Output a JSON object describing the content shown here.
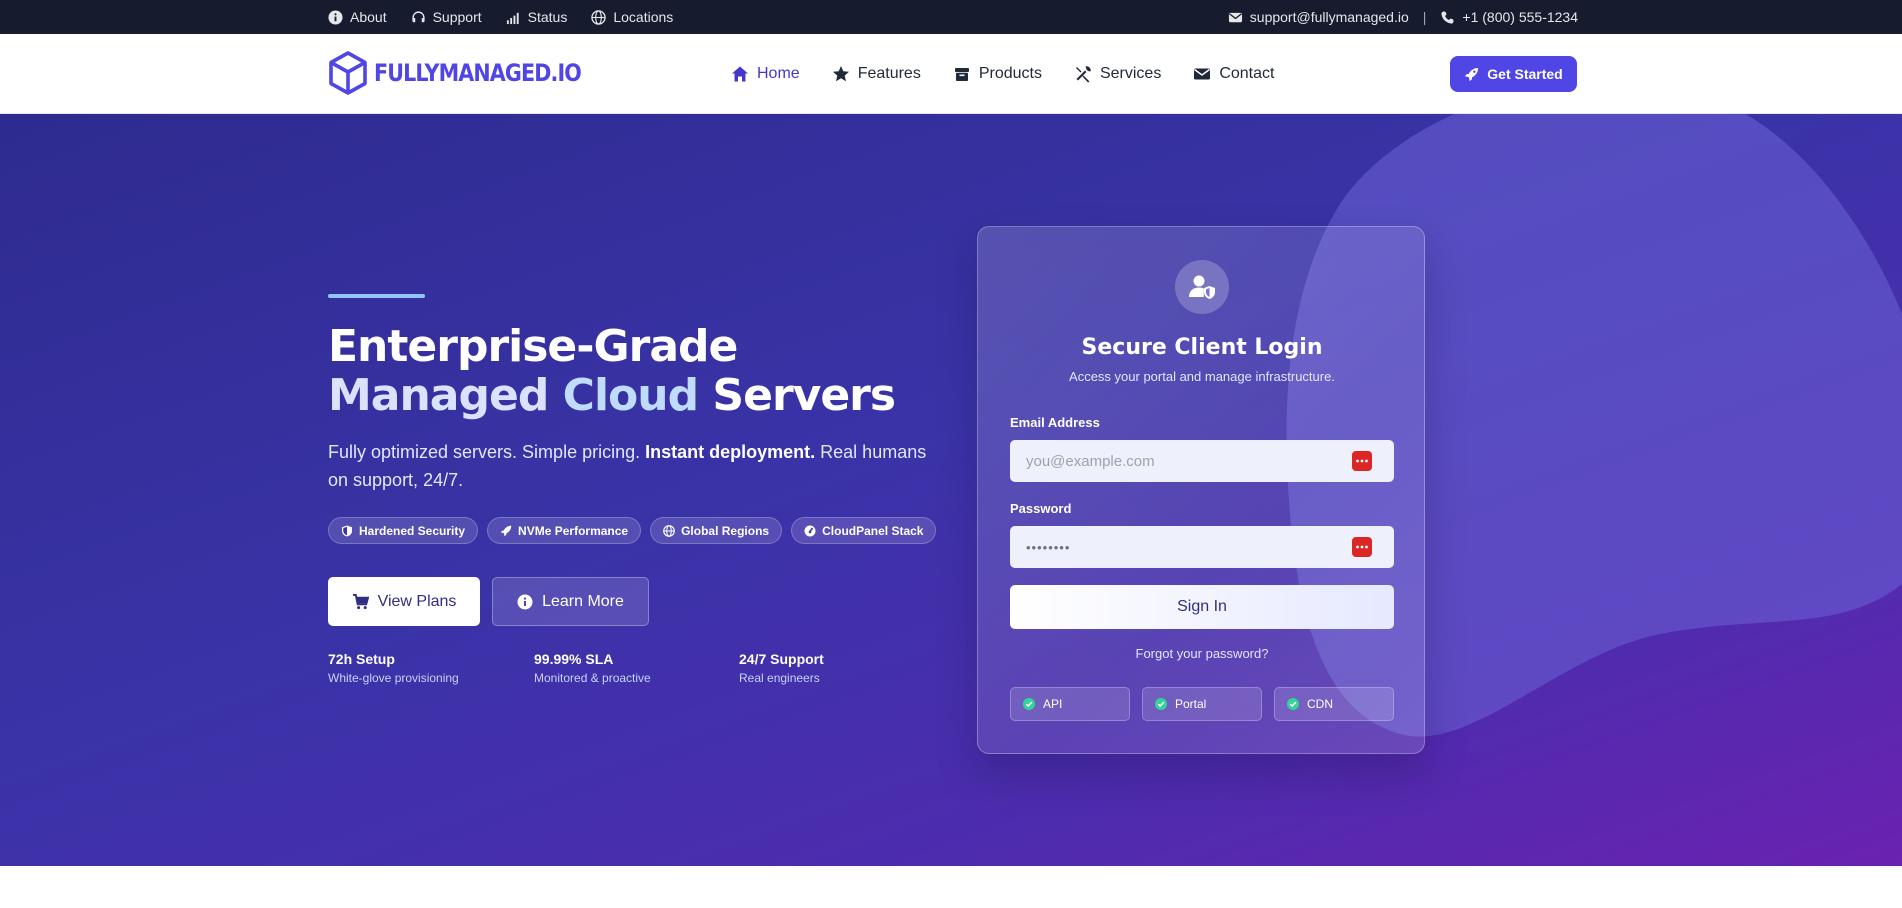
{
  "topbar": {
    "links": [
      {
        "label": "About",
        "icon": "info-icon"
      },
      {
        "label": "Support",
        "icon": "headset-icon"
      },
      {
        "label": "Status",
        "icon": "signal-icon"
      },
      {
        "label": "Locations",
        "icon": "globe-icon"
      }
    ],
    "email": "support@fullymanaged.io",
    "separator": "|",
    "phone": "+1 (800) 555-1234"
  },
  "nav": {
    "logo_text": "FULLYMANAGED.IO",
    "items": [
      {
        "label": "Home",
        "icon": "home-icon",
        "active": true
      },
      {
        "label": "Features",
        "icon": "star-icon",
        "active": false
      },
      {
        "label": "Products",
        "icon": "box-icon",
        "active": false
      },
      {
        "label": "Services",
        "icon": "tools-icon",
        "active": false
      },
      {
        "label": "Contact",
        "icon": "envelope-icon",
        "active": false
      }
    ],
    "cta_label": "Get Started"
  },
  "hero": {
    "headline_line1": "Enterprise-Grade",
    "headline_w1": "Managed",
    "headline_w2": "Cloud",
    "headline_w3": "Servers",
    "lede_part1": "Fully optimized servers. Simple pricing.",
    "lede_bold": "Instant deployment.",
    "lede_part2": "Real humans on support, 24/7.",
    "pills": [
      {
        "label": "Hardened Security",
        "icon": "shield-icon"
      },
      {
        "label": "NVMe Performance",
        "icon": "rocket-icon"
      },
      {
        "label": "Global Regions",
        "icon": "globe-icon"
      },
      {
        "label": "CloudPanel Stack",
        "icon": "gauge-icon"
      }
    ],
    "primary_label": "View Plans",
    "secondary_label": "Learn More",
    "stats": [
      {
        "title": "72h Setup",
        "sub": "White-glove provisioning"
      },
      {
        "title": "99.99% SLA",
        "sub": "Monitored & proactive"
      },
      {
        "title": "24/7 Support",
        "sub": "Real engineers"
      }
    ]
  },
  "login": {
    "title": "Secure Client Login",
    "subtitle": "Access your portal and manage infrastructure.",
    "email_label": "Email Address",
    "email_placeholder": "you@example.com",
    "password_label": "Password",
    "password_value": "••••••••",
    "submit_label": "Sign In",
    "forgot_label": "Forgot your password?",
    "badges": [
      "API",
      "Portal",
      "CDN"
    ]
  },
  "colors": {
    "accent": "#4f46e5",
    "topbar_bg": "#161b2e",
    "hero_start": "#2e2b8f",
    "hero_end": "#6a22b0",
    "check": "#34d399",
    "password_manager": "#dc2626"
  }
}
